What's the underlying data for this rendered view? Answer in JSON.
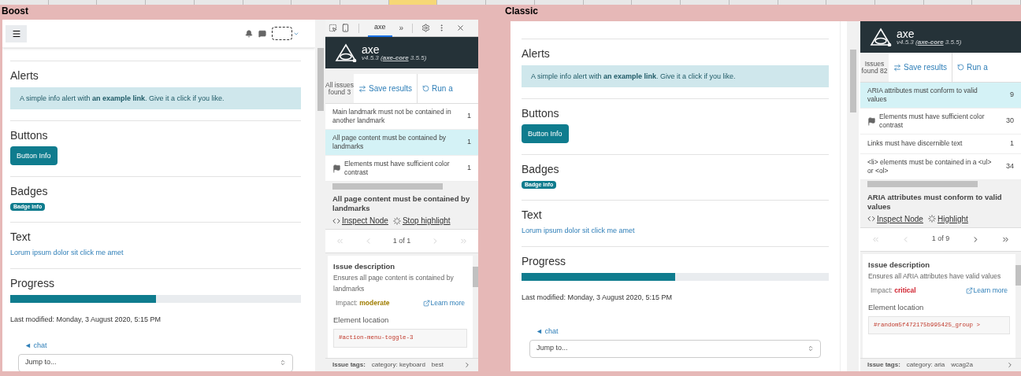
{
  "sheet_header": {
    "cells": [
      {
        "selected": false
      },
      {
        "selected": false
      },
      {
        "selected": false
      },
      {
        "selected": false
      },
      {
        "selected": false
      },
      {
        "selected": false
      },
      {
        "selected": false
      },
      {
        "selected": false
      },
      {
        "selected": true
      },
      {
        "selected": false
      },
      {
        "selected": false
      },
      {
        "selected": false
      },
      {
        "selected": false
      },
      {
        "selected": false
      },
      {
        "selected": false
      },
      {
        "selected": false
      },
      {
        "selected": false
      },
      {
        "selected": false
      },
      {
        "selected": false
      },
      {
        "selected": false
      },
      {
        "selected": false
      }
    ]
  },
  "panels": [
    {
      "label": "Boost",
      "page": {
        "top_bar": true,
        "sections": [
          {
            "kind": "alert",
            "heading": "Alerts",
            "text": "A simple info alert with **an example link**. Give it a click if you like."
          },
          {
            "kind": "button",
            "heading": "Buttons",
            "text": "Button Info"
          },
          {
            "kind": "badge",
            "heading": "Badges",
            "text": "Badge info"
          },
          {
            "kind": "link",
            "heading": "Text",
            "text": "Lorum ipsum dolor sit click me amet"
          },
          {
            "kind": "progress",
            "heading": "Progress",
            "level": 0.5
          }
        ],
        "last_modified": "Last modified: Monday, 3 August 2020, 5:15 PM",
        "chat_link": "◄ chat",
        "jump_select": {
          "value": "Jump to..."
        }
      },
      "devtools": {
        "toolbar": {
          "tabs": [
            {
              "label": "axe",
              "selected": true
            }
          ],
          "more": "»"
        },
        "title": "axe",
        "version_prefix": "v4.5.3 (",
        "core_link": "axe-core",
        "version_suffix": "3.5.5)",
        "summary": "All issues found 3",
        "save": "Save results",
        "run": "Run a",
        "issues": [
          {
            "kind": "plain",
            "title": "Main landmark must not be contained in another landmark",
            "count": "1",
            "selected": false
          },
          {
            "kind": "plain",
            "title": "All page content must be contained by landmarks",
            "count": "1",
            "selected": true
          },
          {
            "kind": "flag",
            "title": "Elements must have sufficient color contrast",
            "count": "1",
            "selected": false
          }
        ],
        "detail": {
          "title": "All page content must be contained by landmarks",
          "inspect": "Inspect Node",
          "highlight": "Stop highlight",
          "position": "1 of 1",
          "prev_enabled": false,
          "next_enabled": false,
          "description_heading": "Issue description",
          "description": "Ensures all page content is contained by landmarks",
          "impact_label": "Impact:",
          "impact_kind": "moderate",
          "learn_more": "Learn more",
          "location_heading": "Element location",
          "selector": "#action-menu-toggle-3",
          "tags_label": "Issue tags:",
          "tags": [
            "category: keyboard",
            "best"
          ]
        }
      }
    },
    {
      "label": "Classic",
      "page": {
        "top_bar": false,
        "sections": [
          {
            "kind": "alert",
            "heading": "Alerts",
            "text": "A simple info alert with **an example link**. Give it a click if you like."
          },
          {
            "kind": "button",
            "heading": "Buttons",
            "text": "Button Info"
          },
          {
            "kind": "badge",
            "heading": "Badges",
            "text": "Badge info"
          },
          {
            "kind": "link",
            "heading": "Text",
            "text": "Lorum ipsum dolor sit click me amet"
          },
          {
            "kind": "progress",
            "heading": "Progress",
            "level": 0.5
          }
        ],
        "last_modified": "Last modified: Monday, 3 August 2020, 5:15 PM",
        "chat_link": "◄ chat",
        "jump_select": {
          "value": "Jump to..."
        }
      },
      "devtools": {
        "title": "axe",
        "version_prefix": "v4.5.3 (",
        "core_link": "axe-core",
        "version_suffix": "3.5.5)",
        "summary": "Issues found 82",
        "save": "Save results",
        "run": "Run a",
        "issues": [
          {
            "kind": "plain",
            "title": "ARIA attributes must conform to valid values",
            "count": "9",
            "selected": true
          },
          {
            "kind": "flag",
            "title": "Elements must have sufficient color contrast",
            "count": "30",
            "selected": false
          },
          {
            "kind": "plain",
            "title": "Links must have discernible text",
            "count": "1",
            "selected": false
          },
          {
            "kind": "plain",
            "title": "<li> elements must be contained in a <ul> or <ol>",
            "count": "34",
            "selected": false
          }
        ],
        "detail": {
          "title": "ARIA attributes must conform to valid values",
          "inspect": "Inspect Node",
          "highlight": "Highlight",
          "position": "1 of 9",
          "prev_enabled": false,
          "next_enabled": true,
          "description_heading": "Issue description",
          "description": "Ensures all ARIA attributes have valid values",
          "impact_label": "Impact:",
          "impact_kind": "critical",
          "learn_more": "Learn more",
          "location_heading": "Element location",
          "selector": "#random5f472175b995425_group >",
          "tags_label": "Issue tags:",
          "tags": [
            "category: aria",
            "wcag2a"
          ]
        }
      }
    }
  ]
}
